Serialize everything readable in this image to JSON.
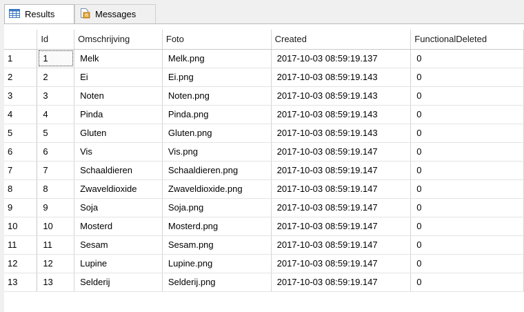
{
  "tabs": [
    {
      "label": "Results",
      "icon": "grid-icon",
      "active": true
    },
    {
      "label": "Messages",
      "icon": "document-icon",
      "active": false
    }
  ],
  "grid": {
    "columns": [
      "Id",
      "Omschrijving",
      "Foto",
      "Created",
      "FunctionalDeleted"
    ],
    "rows": [
      {
        "num": "1",
        "cells": [
          "1",
          "Melk",
          "Melk.png",
          "2017-10-03 08:59:19.137",
          "0"
        ]
      },
      {
        "num": "2",
        "cells": [
          "2",
          "Ei",
          "Ei.png",
          "2017-10-03 08:59:19.143",
          "0"
        ]
      },
      {
        "num": "3",
        "cells": [
          "3",
          "Noten",
          "Noten.png",
          "2017-10-03 08:59:19.143",
          "0"
        ]
      },
      {
        "num": "4",
        "cells": [
          "4",
          "Pinda",
          "Pinda.png",
          "2017-10-03 08:59:19.143",
          "0"
        ]
      },
      {
        "num": "5",
        "cells": [
          "5",
          "Gluten",
          "Gluten.png",
          "2017-10-03 08:59:19.143",
          "0"
        ]
      },
      {
        "num": "6",
        "cells": [
          "6",
          "Vis",
          "Vis.png",
          "2017-10-03 08:59:19.147",
          "0"
        ]
      },
      {
        "num": "7",
        "cells": [
          "7",
          "Schaaldieren",
          "Schaaldieren.png",
          "2017-10-03 08:59:19.147",
          "0"
        ]
      },
      {
        "num": "8",
        "cells": [
          "8",
          "Zwaveldioxide",
          "Zwaveldioxide.png",
          "2017-10-03 08:59:19.147",
          "0"
        ]
      },
      {
        "num": "9",
        "cells": [
          "9",
          "Soja",
          "Soja.png",
          "2017-10-03 08:59:19.147",
          "0"
        ]
      },
      {
        "num": "10",
        "cells": [
          "10",
          "Mosterd",
          "Mosterd.png",
          "2017-10-03 08:59:19.147",
          "0"
        ]
      },
      {
        "num": "11",
        "cells": [
          "11",
          "Sesam",
          "Sesam.png",
          "2017-10-03 08:59:19.147",
          "0"
        ]
      },
      {
        "num": "12",
        "cells": [
          "12",
          "Lupine",
          "Lupine.png",
          "2017-10-03 08:59:19.147",
          "0"
        ]
      },
      {
        "num": "13",
        "cells": [
          "13",
          "Selderij",
          "Selderij.png",
          "2017-10-03 08:59:19.147",
          "0"
        ]
      }
    ],
    "selected_cell": {
      "row": 0,
      "col": 0
    }
  },
  "colors": {
    "grid_icon_blue": "#3a78c2",
    "doc_icon_orange": "#e0a030",
    "selection_outline": "#333333"
  }
}
